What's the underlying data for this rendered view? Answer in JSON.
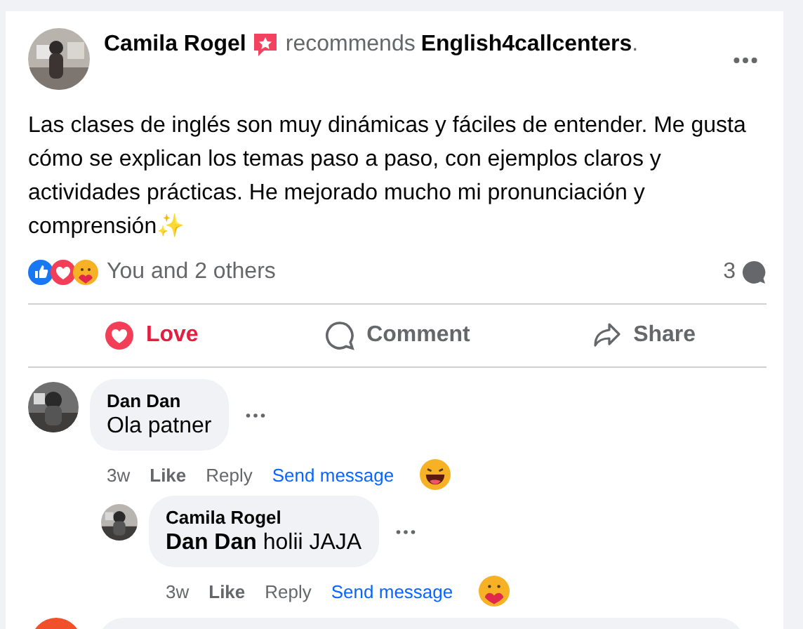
{
  "post": {
    "author": "Camila Rogel",
    "verb": "recommends",
    "page": "English4callcenters",
    "period": ".",
    "text": "Las clases de inglés son muy dinámicas y fáciles de entender. Me gusta cómo se explican los temas paso a paso, con ejemplos claros y actividades prácticas. He mejorado mucho mi pronunciación y comprensión✨"
  },
  "reactions": {
    "summary": "You and 2 others",
    "comment_count": "3",
    "types": [
      {
        "kind": "like"
      },
      {
        "kind": "love"
      },
      {
        "kind": "care"
      }
    ]
  },
  "actions": [
    {
      "kind": "love",
      "label": "Love",
      "selected": true
    },
    {
      "kind": "comment",
      "label": "Comment",
      "selected": false
    },
    {
      "kind": "share",
      "label": "Share",
      "selected": false
    }
  ],
  "comments": [
    {
      "author": "Dan Dan",
      "text": "Ola patner",
      "time": "3w",
      "like": "Like",
      "reply": "Reply",
      "message": "Send message",
      "reaction": {
        "kind": "laugh"
      },
      "reply_level": false
    },
    {
      "author": "Camila Rogel",
      "text": "**Dan Dan** holii JAJA",
      "time": "3w",
      "like": "Like",
      "reply": "Reply",
      "message": "Send message",
      "reaction": {
        "kind": "care"
      },
      "reply_level": true
    }
  ]
}
